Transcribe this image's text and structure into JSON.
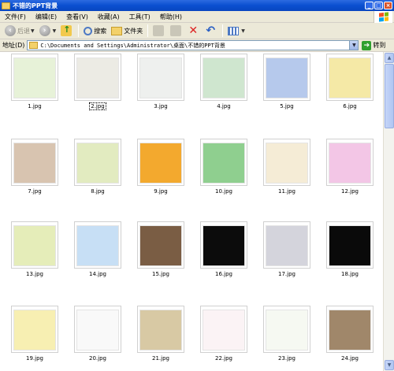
{
  "window": {
    "title": "不错的PPT背景"
  },
  "menu": {
    "items": [
      "文件(F)",
      "编辑(E)",
      "查看(V)",
      "收藏(A)",
      "工具(T)",
      "帮助(H)"
    ]
  },
  "toolbar": {
    "back_label": "后退",
    "search_label": "搜索",
    "folders_label": "文件夹"
  },
  "address": {
    "label": "地址(D)",
    "path": "C:\\Documents and Settings\\Administrator\\桌面\\不错的PPT背景",
    "go_label": "转到"
  },
  "files": [
    {
      "name": "1.jpg"
    },
    {
      "name": "2.jpg"
    },
    {
      "name": "3.jpg"
    },
    {
      "name": "4.jpg"
    },
    {
      "name": "5.jpg"
    },
    {
      "name": "6.jpg"
    },
    {
      "name": "7.jpg"
    },
    {
      "name": "8.jpg"
    },
    {
      "name": "9.jpg"
    },
    {
      "name": "10.jpg"
    },
    {
      "name": "11.jpg"
    },
    {
      "name": "12.jpg"
    },
    {
      "name": "13.jpg"
    },
    {
      "name": "14.jpg"
    },
    {
      "name": "15.jpg"
    },
    {
      "name": "16.jpg"
    },
    {
      "name": "17.jpg"
    },
    {
      "name": "18.jpg"
    },
    {
      "name": "19.jpg"
    },
    {
      "name": "20.jpg"
    },
    {
      "name": "21.jpg"
    },
    {
      "name": "22.jpg"
    },
    {
      "name": "23.jpg"
    },
    {
      "name": "24.jpg"
    }
  ],
  "selected_file": "2.jpg",
  "thumb_colors": [
    "#e7f2d8",
    "#ecebe4",
    "#eef0ee",
    "#cfe6cf",
    "#b6c9ec",
    "#f5e9a6",
    "#d8c4b0",
    "#e2ebc0",
    "#f3a92e",
    "#8fcf8f",
    "#f5ecd6",
    "#f3c6e6",
    "#e5edb9",
    "#c7dff5",
    "#7a5d44",
    "#0c0c0c",
    "#d4d4dc",
    "#0a0a0a",
    "#f7efb2",
    "#f9f9f9",
    "#d8c9a4",
    "#fbf3f5",
    "#f6f9f2",
    "#a0876a"
  ],
  "colors": {
    "titlebar": "#0a4fd0",
    "chrome": "#ece9d8"
  }
}
